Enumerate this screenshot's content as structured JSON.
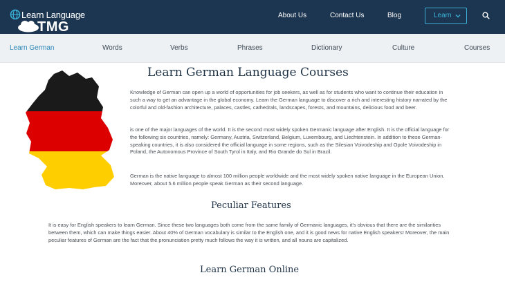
{
  "header": {
    "logo_text": "Learn Language",
    "logo_sub": "TMG",
    "nav": [
      "About Us",
      "Contact Us",
      "Blog"
    ],
    "learn_button": "Learn",
    "colors": {
      "bar": "#1c3651",
      "accent": "#3ab0d6"
    }
  },
  "subnav": {
    "items": [
      "Learn German",
      "Words",
      "Verbs",
      "Phrases",
      "Dictionary",
      "Culture",
      "Courses"
    ],
    "active": "Learn German"
  },
  "main": {
    "title": "Learn German Language Courses",
    "p1": "Knowledge of German can open up a world of opportunities for job seekers, as well as for students who want to continue their education in such a way to get an advantage in the global economy. Learn the German language to discover a rich and interesting history narrated by the colorful and old-fashion architecture, palaces, castles, cathedrals, landscapes, forests, and mountains, delicious food and beer.",
    "p2": "is one of the major languages of the world. It is the second most widely spoken Germanic language after English. It is the official language for the following six countries, namely: Germany, Austria, Switzerland, Belgium, Luxembourg, and Liechtenstein. In addition to these German-speaking countries, it is also considered the official language in some regions, such as the Silesian Voivodeship and Opole Voivodeship in Poland, the Autonomous Province of South Tyrol in Italy, and Rio Grande do Sul in Brazil.",
    "p3": "German is the native language to almost 100 million people worldwide and the most widely spoken native language in the European Union. Moreover, about 5.6 million people speak German as their second language.",
    "h_features": "Peculiar Features",
    "p4": "It is easy for English speakers to learn German. Since these two languages both come from the same family of Germanic languages, it's obvious that there are the similarities between them, which can make things easier. About 40% of German vocabulary is similar to the English one, and it is good news for native English speakers! Moreover, the main peculiar features of German are the fact that the pronunciation pretty much follows the way it is written, and all nouns are capitalized.",
    "h_online": "Learn German Online"
  },
  "flag_colors": {
    "black": "#1a1a1a",
    "red": "#dd0000",
    "gold": "#ffce00"
  }
}
